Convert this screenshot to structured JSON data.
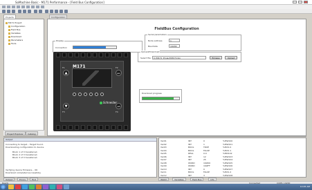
{
  "window": {
    "title": "SoMachine Basic - M171 Performance - [Field Bus Configuration]"
  },
  "tabs": [
    {
      "label": "Projects"
    },
    {
      "label": "Configuration"
    }
  ],
  "sidebar": {
    "items": [
      {
        "label": "M171 Project"
      },
      {
        "label": "Configuration"
      },
      {
        "label": "Field Bus"
      },
      {
        "label": "Variables"
      },
      {
        "label": "Download"
      },
      {
        "label": "Parameters"
      },
      {
        "label": "Tools"
      }
    ],
    "bottom_buttons": [
      {
        "label": "Project Explorer"
      },
      {
        "label": "Catalog"
      }
    ]
  },
  "main": {
    "title": "FieldBus Configuration",
    "display_group": {
      "legend": "Display",
      "connection_label": "Connection",
      "progress_fraction": 0.75
    },
    "serial_group": {
      "legend": "Serial parameters",
      "address_label": "Node address",
      "address_value": "1",
      "baudrate_label": "Baudrate",
      "baudrate_value": "19200"
    },
    "file_group": {
      "legend": "Upload/Download",
      "file_label": "Select file",
      "file_value": "C:\\M171_Project\\M171.bin",
      "browse_label": "Browse",
      "upload_label": "Upload"
    },
    "download_popup": {
      "label": "Download progress",
      "progress_fraction": 0.85
    },
    "device": {
      "model": "M171",
      "brand": "Schneider",
      "keys": [
        {
          "key": "F1",
          "symbol": "▲"
        },
        {
          "key": "F2",
          "symbol": "esc"
        },
        {
          "key": "F3",
          "symbol": "▼"
        },
        {
          "key": "F4",
          "symbol": "set"
        }
      ]
    }
  },
  "console": {
    "header": "Output",
    "lines": [
      "Connecting to target... Target found.",
      "Downloading configuration to device.",
      "Block 1 of 3 transferred.",
      "Block 2 of 3 transferred.",
      "Block 3 of 3 transferred.",
      "Verifying device firmware... OK",
      "Download completed successfully."
    ],
    "tabs": [
      {
        "label": "Output"
      },
      {
        "label": "Errors"
      },
      {
        "label": "Find"
      }
    ]
  },
  "variables": {
    "rows": [
      [
        "Var01",
        "INT",
        "0",
        "%MW100"
      ],
      [
        "Var02",
        "INT",
        "1",
        "%MW101"
      ],
      [
        "Var03",
        "BOOL",
        "TRUE",
        "%MX1.0"
      ],
      [
        "Var04",
        "BOOL",
        "FALSE",
        "%MX1.1"
      ],
      [
        "Var05",
        "REAL",
        "0.0",
        "%MD102"
      ],
      [
        "Var06",
        "INT",
        "12",
        "%MW103"
      ],
      [
        "Var07",
        "INT",
        "25",
        "%MW104"
      ],
      [
        "Var08",
        "WORD",
        "16#00",
        "%MW105"
      ],
      [
        "Var09",
        "WORD",
        "16#FF",
        "%MW106"
      ],
      [
        "Var10",
        "INT",
        "0",
        "%MW107"
      ],
      [
        "Var11",
        "BOOL",
        "FALSE",
        "%MX1.2"
      ],
      [
        "Var12",
        "INT",
        "3",
        "%MW108"
      ]
    ],
    "tabs": [
      {
        "label": "Watch"
      },
      {
        "label": "Variables"
      },
      {
        "label": "Field Bus"
      },
      {
        "label": "Info"
      }
    ]
  },
  "statusbar": {
    "left": "Ready",
    "right1": "Connected",
    "right2": "COM1 19200"
  },
  "taskbar": {
    "time": "10:45 AM"
  }
}
